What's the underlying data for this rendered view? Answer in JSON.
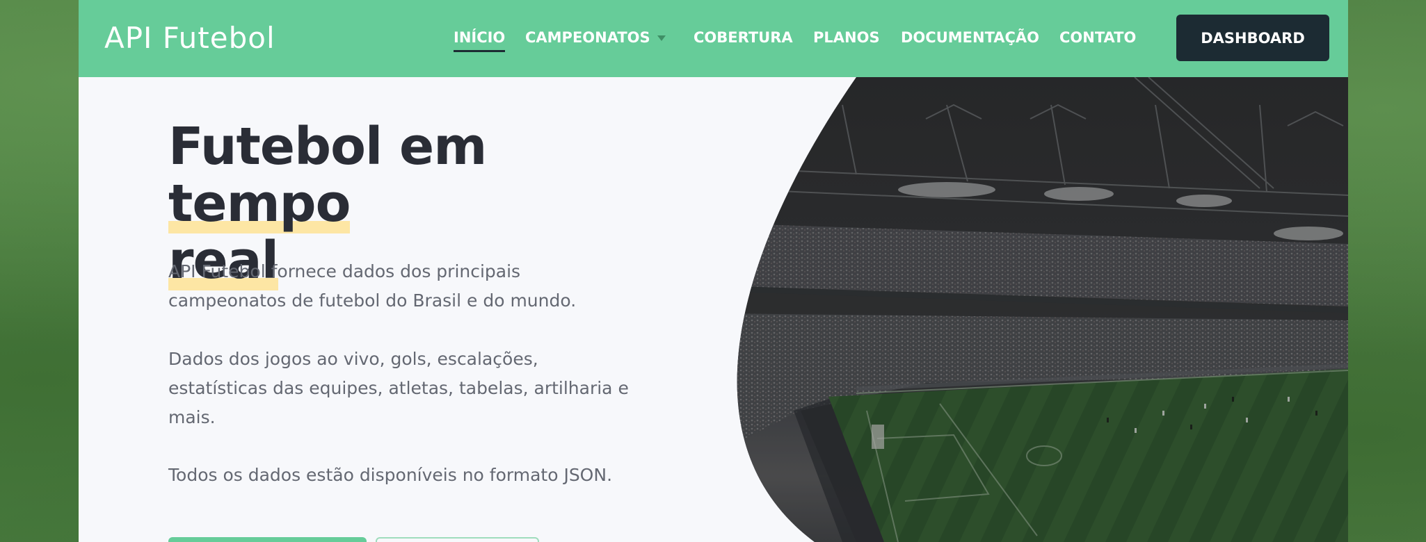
{
  "brand": {
    "logo_text": "API Futebol"
  },
  "nav": {
    "items": [
      {
        "label": "INÍCIO",
        "active": true
      },
      {
        "label": "CAMPEONATOS",
        "has_dropdown": true
      },
      {
        "label": "COBERTURA"
      },
      {
        "label": "PLANOS"
      },
      {
        "label": "DOCUMENTAÇÃO"
      },
      {
        "label": "CONTATO"
      }
    ],
    "cta_label": "DASHBOARD"
  },
  "hero": {
    "title_part1": "Futebol em ",
    "title_highlight_1": "tempo",
    "title_highlight_2": "real",
    "paragraph_1": "API Futebol fornece dados dos principais campeonatos de futebol do Brasil e do mundo.",
    "paragraph_2": "Dados dos jogos ao vivo, gols, escalações, estatísticas das equipes, atletas, tabelas, artilharia e mais.",
    "paragraph_3": "Todos os dados estão disponíveis no formato JSON."
  },
  "colors": {
    "brand_green": "#66cc99",
    "dark_navy": "#1c2b33",
    "highlight_yellow": "#fde6a4",
    "page_bg": "#f7f8fb"
  },
  "icons": {
    "dropdown": "chevron-down-icon"
  }
}
